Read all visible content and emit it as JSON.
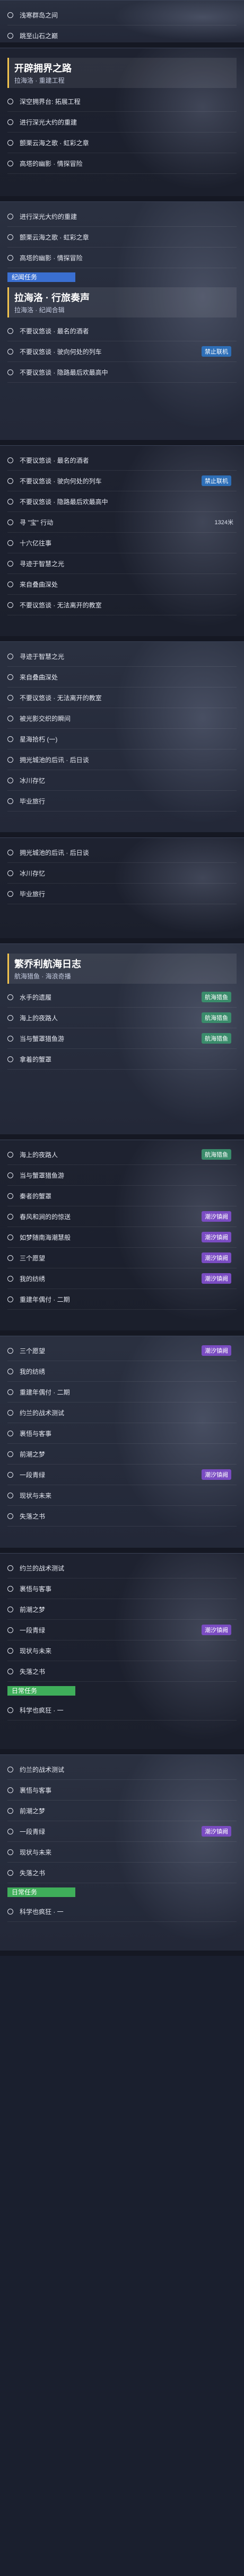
{
  "panels": [
    {
      "id": "p1",
      "rows": [
        "浅寒群岛之间",
        "跳至山石之巅"
      ]
    },
    {
      "id": "p2",
      "section": {
        "title": "开辟拥界之路",
        "subtitle": "拉海洛 · 重建工程"
      },
      "rows": [
        "深空拥界台: 拓展工程",
        "进行深光大约的重建",
        "颤栗云海之歌 · 虹彩之章",
        "高塔的幽影 · 情探冒险"
      ]
    },
    {
      "id": "p3",
      "rows": [
        "进行深光大约的重建",
        "颤栗云海之歌 · 虹彩之章",
        "高塔的幽影 · 情探冒险"
      ],
      "tag": "纪闻任务",
      "section": {
        "title": "拉海洛 · 行旅奏声",
        "subtitle": "拉海洛 · 纪闻合辑"
      },
      "rows2": [
        {
          "t": "不要议悠谈 · 最名的酒者",
          "b": ""
        },
        {
          "t": "不要议悠谈 · 驶向何处的列车",
          "b": "禁止联机"
        },
        {
          "t": "不要议悠谈 · 隐路最后欢最高中",
          "b": ""
        }
      ]
    },
    {
      "id": "p4",
      "rows": [
        {
          "t": "不要议悠谈 · 最名的酒者",
          "b": ""
        },
        {
          "t": "不要议悠谈 · 驶向何处的列车",
          "b": "禁止联机"
        },
        {
          "t": "不要议悠谈 · 隐路最后欢最高中",
          "b": ""
        },
        {
          "t": "寻 \"宝\" 行动",
          "b": "",
          "r": "1324米"
        },
        {
          "t": "十六亿往事",
          "b": ""
        },
        {
          "t": "寻迹于智慧之光",
          "b": ""
        },
        {
          "t": "来自叠曲深处",
          "b": ""
        },
        {
          "t": "不要议悠谈 · 无法离开的教室",
          "b": ""
        }
      ]
    },
    {
      "id": "p5",
      "rows": [
        {
          "t": "寻迹于智慧之光",
          "b": ""
        },
        {
          "t": "来自叠曲深处",
          "b": ""
        },
        {
          "t": "不要议悠谈 · 无法离开的教室",
          "b": ""
        },
        {
          "t": "被光影交织的瞬间",
          "b": ""
        },
        {
          "t": "星海拾朽 (一)",
          "b": ""
        },
        {
          "t": "拥光城池的后讯 · 后日谈",
          "b": ""
        },
        {
          "t": "冰川存忆",
          "b": ""
        },
        {
          "t": "毕业旅行",
          "b": ""
        }
      ]
    },
    {
      "id": "p6",
      "rows": [
        "拥光城池的后讯 · 后日谈",
        "冰川存忆",
        "毕业旅行"
      ]
    },
    {
      "id": "p7",
      "section": {
        "title": "繁乔利航海日志",
        "subtitle": "航海猎鱼 · 海浪奇播"
      },
      "rows": [
        {
          "t": "水手的遗履",
          "b": "航海猎鱼"
        },
        {
          "t": "海上的夜路人",
          "b": "航海猎鱼"
        },
        {
          "t": "当与蟹罩猎鱼游",
          "b": "航海猎鱼"
        },
        {
          "t": "拿着的蟹罩",
          "b": ""
        }
      ]
    },
    {
      "id": "p8",
      "rows": [
        {
          "t": "海上的夜路人",
          "b": "航海猎鱼"
        },
        {
          "t": "当与蟹罩猎鱼游",
          "b": ""
        },
        {
          "t": "秦者的蟹罩",
          "b": ""
        },
        {
          "t": "春风和涧的的惊送",
          "b": "潮汐镇阙"
        },
        {
          "t": "如梦随南海潮慧般",
          "b": "潮汐镇阙"
        },
        {
          "t": "三个愿望",
          "b": "潮汐镇阙"
        },
        {
          "t": "我的纺绣",
          "b": "潮汐镇阙"
        },
        {
          "t": "重建年偶付 · 二期",
          "b": ""
        }
      ]
    },
    {
      "id": "p9",
      "rows": [
        {
          "t": "三个愿望",
          "b": "潮汐镇阙"
        },
        {
          "t": "我的纺绣",
          "b": ""
        },
        {
          "t": "重建年偶付 · 二期",
          "b": ""
        },
        {
          "t": "约兰的战术测试",
          "b": ""
        },
        {
          "t": "裹悟与客事",
          "b": ""
        },
        {
          "t": "前潮之梦",
          "b": ""
        },
        {
          "t": "一段青绿",
          "b": "潮汐镇阙"
        },
        {
          "t": "现状与未来",
          "b": ""
        },
        {
          "t": "失落之书",
          "b": ""
        }
      ]
    },
    {
      "id": "p10",
      "rows": [
        {
          "t": "约兰的战术测试",
          "b": ""
        },
        {
          "t": "裹悟与客事",
          "b": ""
        },
        {
          "t": "前潮之梦",
          "b": ""
        },
        {
          "t": "一段青绿",
          "b": "潮汐镇阙"
        },
        {
          "t": "现状与未来",
          "b": ""
        },
        {
          "t": "失落之书",
          "b": ""
        }
      ],
      "tag": "日常任务",
      "rows2": [
        {
          "t": "科学也疯狂 · 一",
          "b": ""
        }
      ]
    },
    {
      "id": "p11",
      "rows": [
        {
          "t": "约兰的战术测试",
          "b": ""
        },
        {
          "t": "裹悟与客事",
          "b": ""
        },
        {
          "t": "前潮之梦",
          "b": ""
        },
        {
          "t": "一段青绿",
          "b": "潮汐镇阙"
        },
        {
          "t": "现状与未来",
          "b": ""
        },
        {
          "t": "失落之书",
          "b": ""
        }
      ],
      "tag": "日常任务",
      "rows2": [
        {
          "t": "科学也疯狂 · 一",
          "b": ""
        }
      ]
    }
  ]
}
